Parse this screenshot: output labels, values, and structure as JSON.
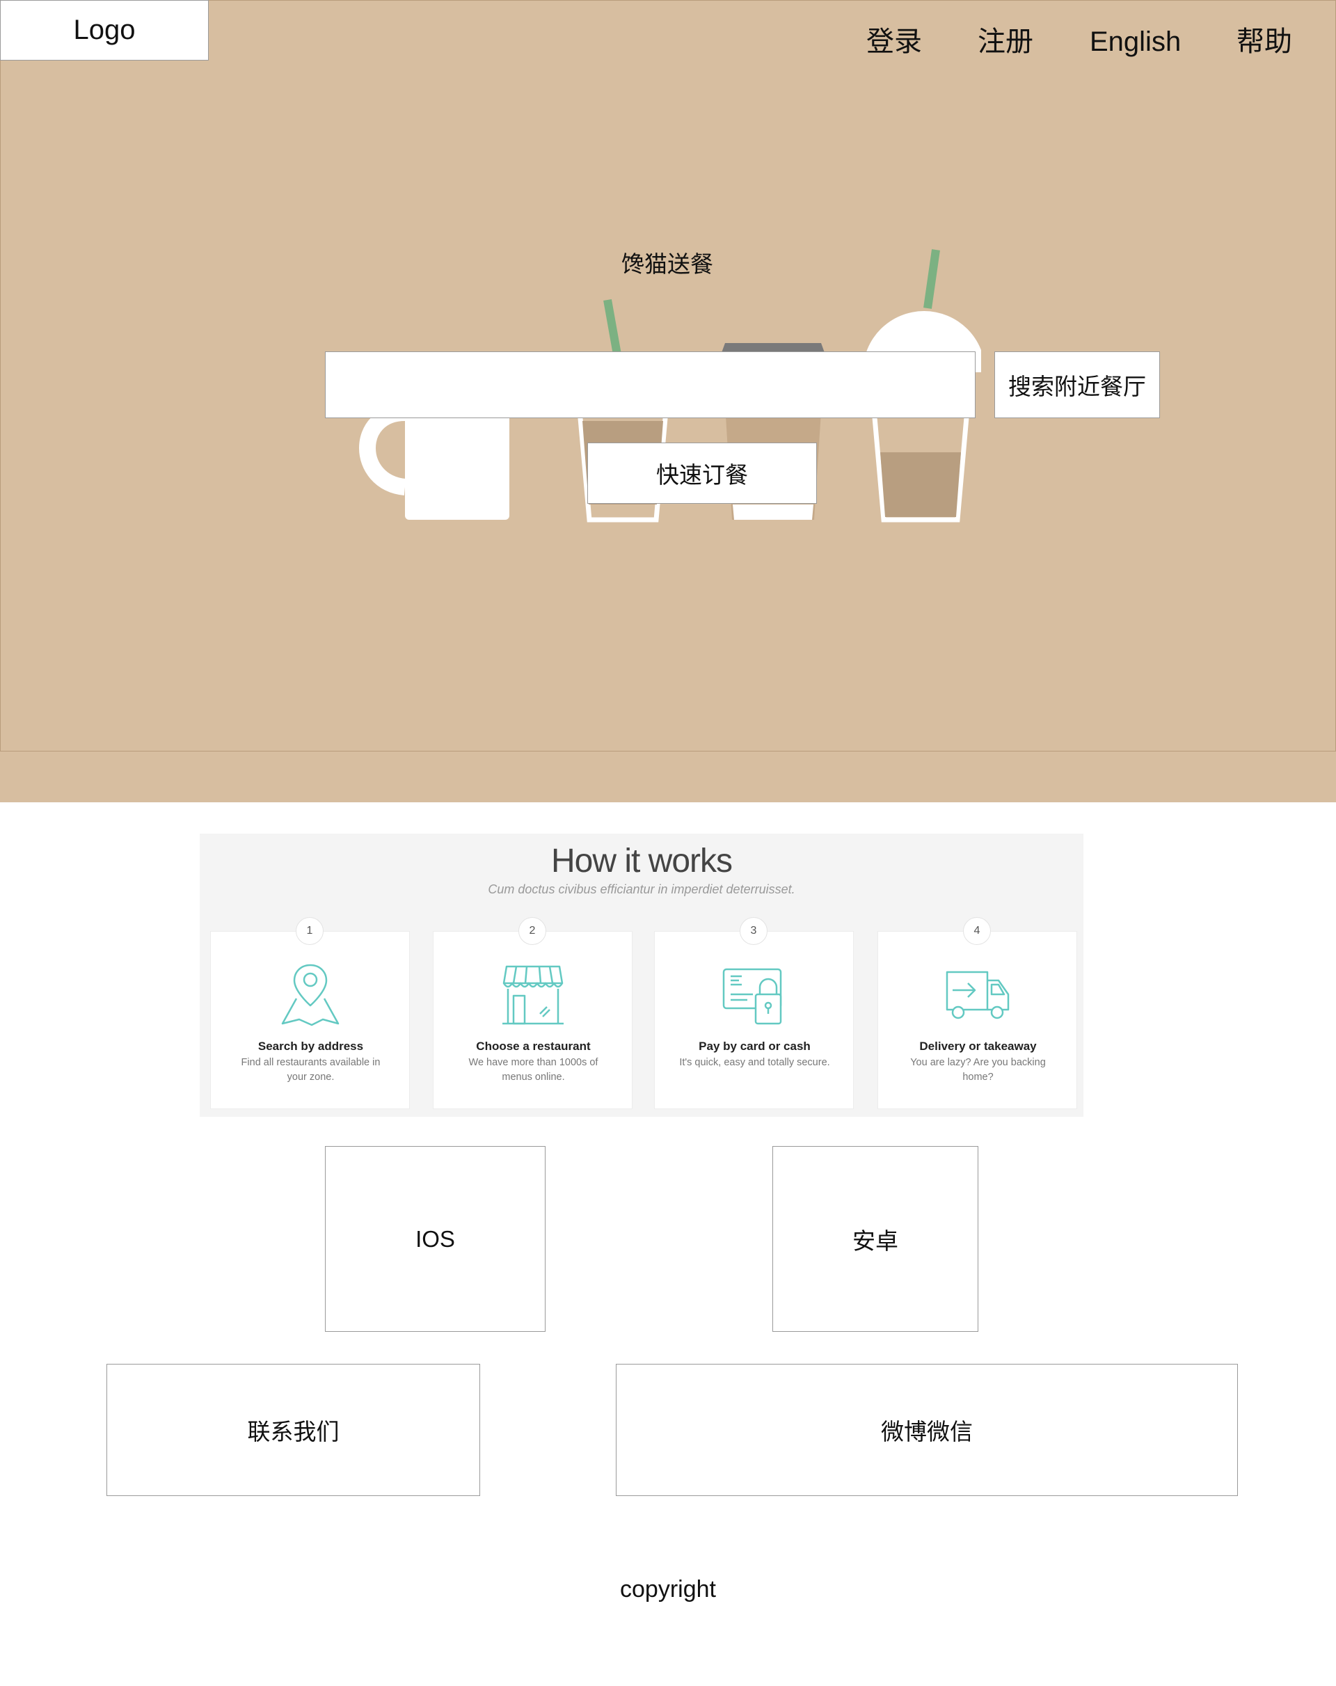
{
  "header": {
    "logo": "Logo",
    "nav": {
      "login": "登录",
      "register": "注册",
      "language": "English",
      "help": "帮助"
    }
  },
  "hero": {
    "title": "馋猫送餐",
    "search": {
      "value": "",
      "placeholder": ""
    },
    "search_button": "搜索附近餐厅",
    "quick_order_button": "快速订餐"
  },
  "how_it_works": {
    "title": "How it works",
    "subtitle": "Cum doctus civibus efficiantur in imperdiet deterruisset.",
    "steps": [
      {
        "number": "1",
        "title": "Search by address",
        "desc": "Find all restaurants available in your zone.",
        "icon": "map-pin-icon"
      },
      {
        "number": "2",
        "title": "Choose a restaurant",
        "desc": "We have more than 1000s of menus online.",
        "icon": "storefront-icon"
      },
      {
        "number": "3",
        "title": "Pay by card or cash",
        "desc": "It's quick, easy and totally secure.",
        "icon": "card-lock-icon"
      },
      {
        "number": "4",
        "title": "Delivery or takeaway",
        "desc": "You are lazy? Are you backing home?",
        "icon": "delivery-van-icon"
      }
    ]
  },
  "apps": {
    "ios": "IOS",
    "android": "安卓"
  },
  "footer": {
    "contact": "联系我们",
    "social": "微博微信",
    "copyright": "copyright"
  },
  "colors": {
    "hero_bg": "#d7bea0",
    "icon_accent": "#63c9c2",
    "straw": "#7cb182"
  }
}
